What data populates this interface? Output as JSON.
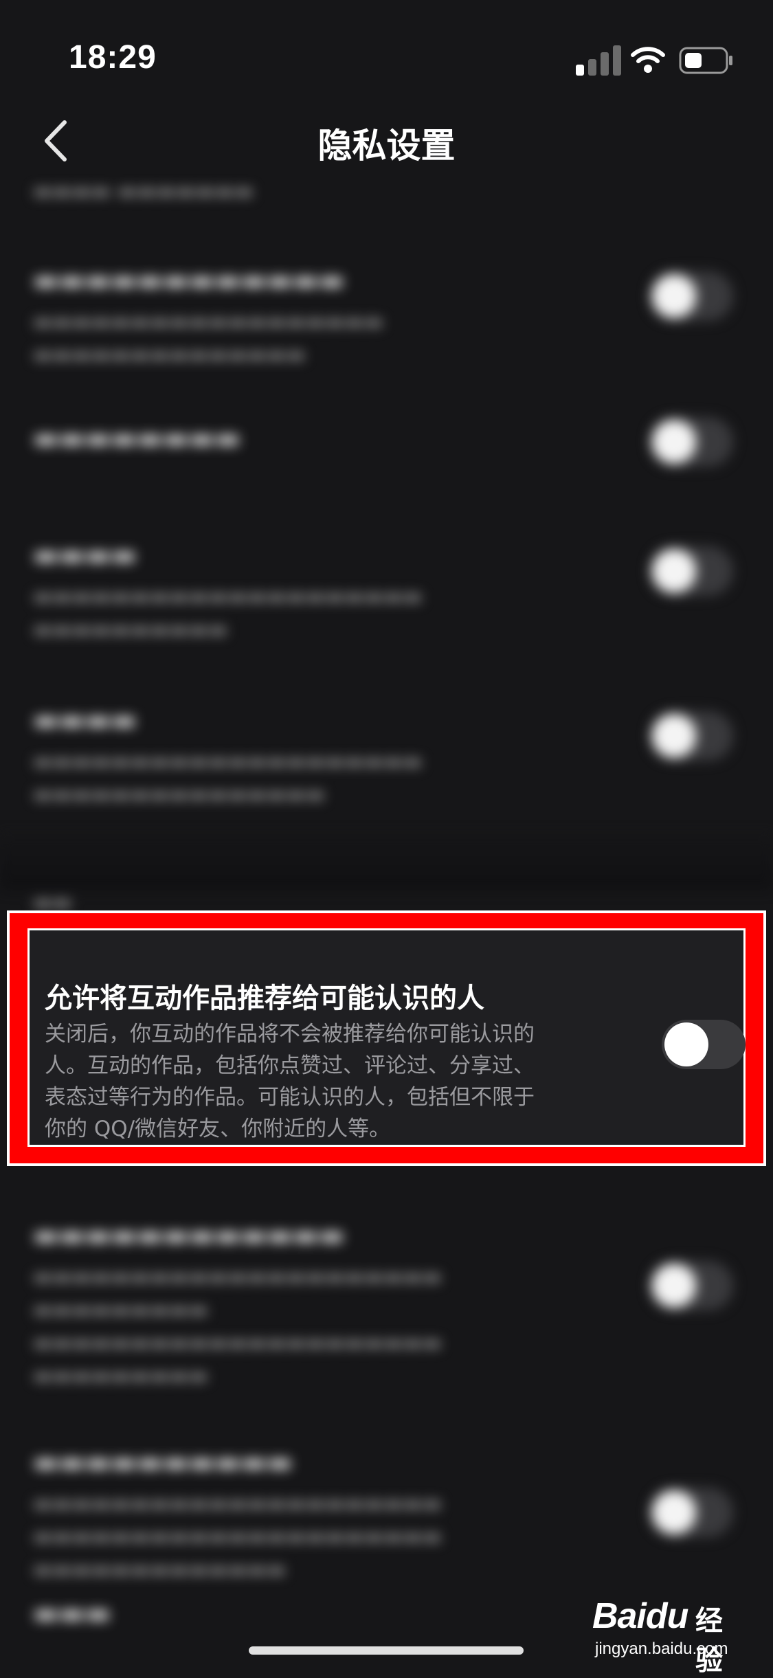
{
  "status_bar": {
    "time": "18:29"
  },
  "nav": {
    "title": "隐私设置"
  },
  "blurred_rows_top": [
    {
      "title": "",
      "desc": ""
    },
    {
      "title": "",
      "desc": ""
    },
    {
      "title": "",
      "desc": ""
    },
    {
      "title": "",
      "desc": ""
    },
    {
      "title": "",
      "desc": ""
    }
  ],
  "highlighted_setting": {
    "title": "允许将互动作品推荐给可能认识的人",
    "desc_line1": "关闭后，你互动的作品将不会被推荐给你可能认识的",
    "desc_line2": "人。互动的作品，包括你点赞过、评论过、分享过、",
    "desc_line3": "表态过等行为的作品。可能认识的人，包括但不限于",
    "desc_line4": "你的 QQ/微信好友、你附近的人等。",
    "toggle_on": false
  },
  "watermark": {
    "brand": "Baidu",
    "product": "经验",
    "url": "jingyan.baidu.com"
  },
  "colors": {
    "background": "#161618",
    "highlight_border": "#ff0000",
    "toggle_off": "#3a3a3d"
  }
}
